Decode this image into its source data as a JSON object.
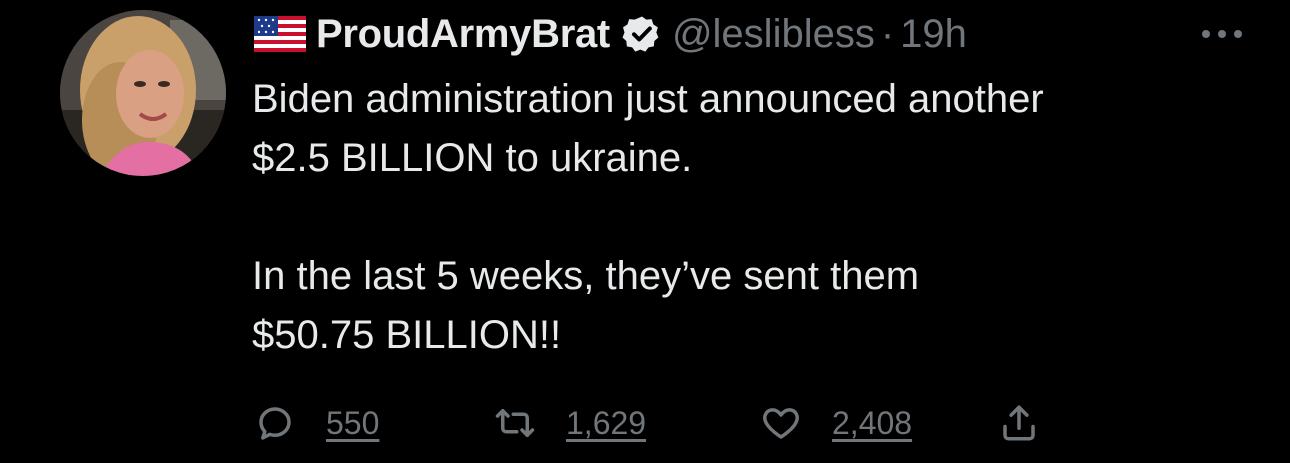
{
  "tweet": {
    "author": {
      "flag_icon": "us-flag-icon",
      "display_name": "ProudArmyBrat",
      "verified_icon": "verified-badge-icon",
      "handle": "@leslibless",
      "separator": "·",
      "time": "19h"
    },
    "more_icon": "more-options-icon",
    "text_lines_para1": [
      "Biden administration just announced another",
      "$2.5 BILLION to ukraine."
    ],
    "text_lines_para2": [
      "In the last 5 weeks, they’ve sent them",
      "$50.75 BILLION!!"
    ],
    "actions": {
      "reply": {
        "icon": "reply-icon",
        "count": "550"
      },
      "retweet": {
        "icon": "retweet-icon",
        "count": "1,629"
      },
      "like": {
        "icon": "heart-icon",
        "count": "2,408"
      },
      "share": {
        "icon": "share-icon"
      }
    }
  },
  "colors": {
    "background": "#000000",
    "primary_text": "#e7e9ea",
    "secondary_text": "#71767b"
  }
}
